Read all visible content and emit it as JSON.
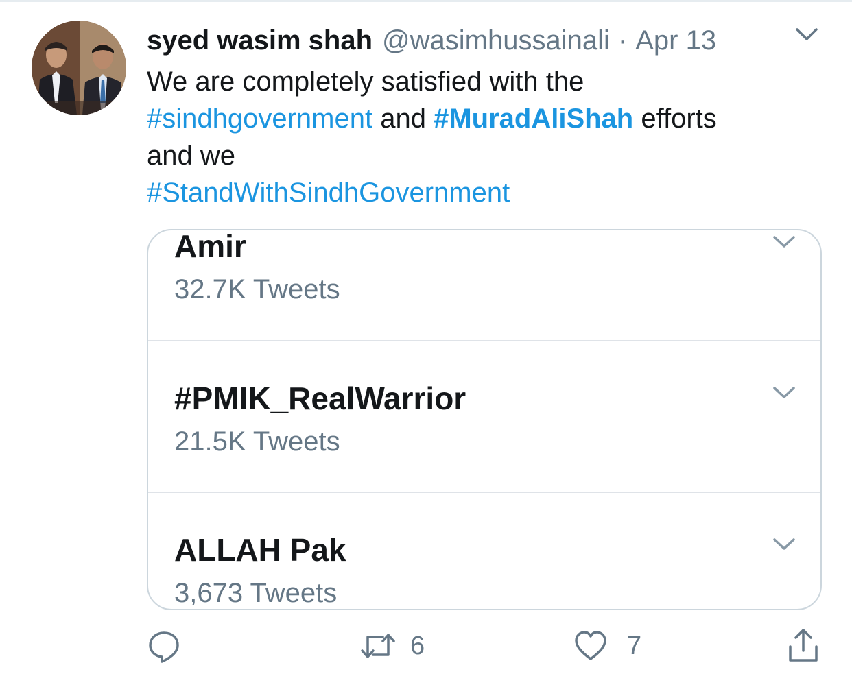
{
  "tweet": {
    "author_name": "syed wasim shah",
    "handle": "@wasimhussainali",
    "separator": "·",
    "date": "Apr 13",
    "text_line1": "We are completely satisfied with the",
    "hashtag1": "#sindhgovernment",
    "text_and": " and ",
    "hashtag2": "#MuradAliShah",
    "text_efforts": " efforts",
    "text_line3": "and we",
    "hashtag3": "#StandWithSindhGovernment"
  },
  "trends": [
    {
      "title": "Amir",
      "count": "32.7K Tweets"
    },
    {
      "title": "#PMIK_RealWarrior",
      "count": "21.5K Tweets"
    },
    {
      "title": "ALLAH Pak",
      "count": "3,673 Tweets"
    }
  ],
  "actions": {
    "reply_icon": "reply-bubble-icon",
    "retweet_icon": "retweet-icon",
    "retweet_count": "6",
    "like_icon": "heart-icon",
    "like_count": "7",
    "share_icon": "share-icon"
  },
  "colors": {
    "link": "#1b95e0",
    "text": "#14171a",
    "muted": "#657786",
    "border": "#ccd6dd"
  }
}
